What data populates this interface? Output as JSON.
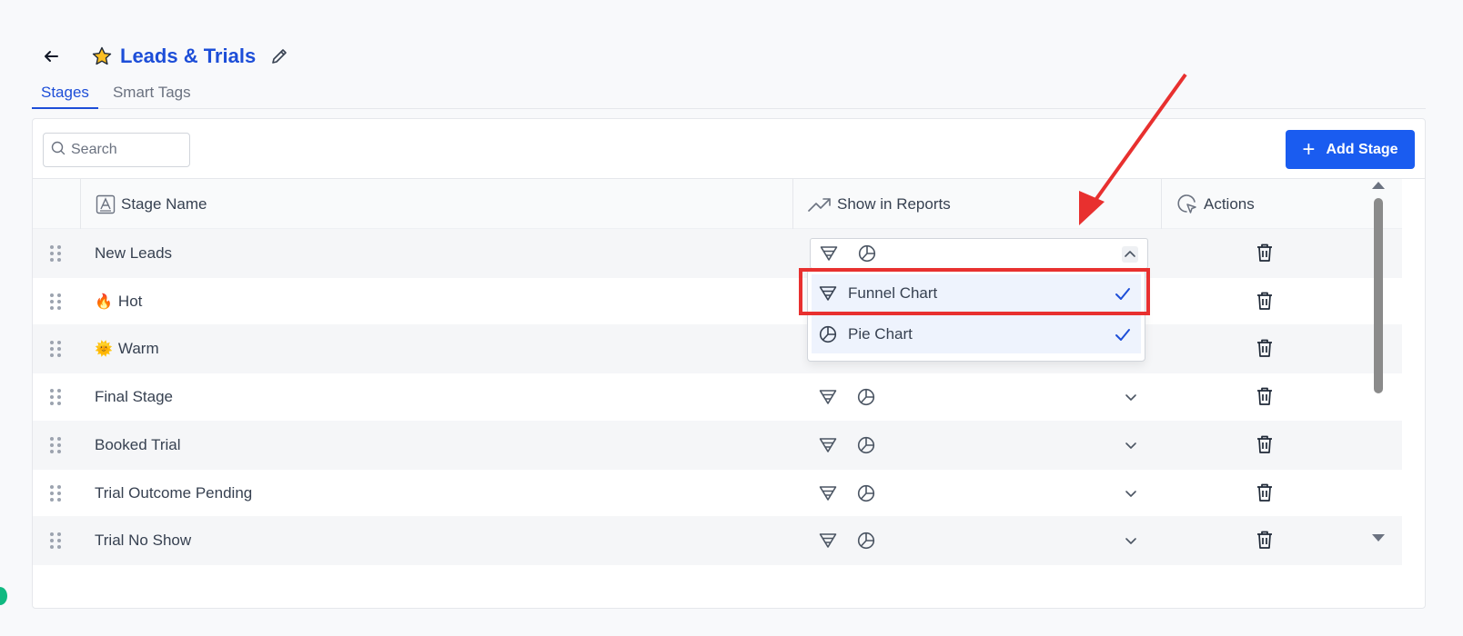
{
  "header": {
    "title": "Leads & Trials"
  },
  "tabs": [
    {
      "label": "Stages",
      "active": true
    },
    {
      "label": "Smart Tags",
      "active": false
    }
  ],
  "toolbar": {
    "search_placeholder": "Search",
    "add_label": "Add Stage"
  },
  "columns": {
    "stage_name": "Stage Name",
    "show_in_reports": "Show in Reports",
    "actions": "Actions"
  },
  "rows": [
    {
      "name": "New Leads",
      "emoji": ""
    },
    {
      "name": "Hot",
      "emoji": "🔥"
    },
    {
      "name": "Warm",
      "emoji": "🌞"
    },
    {
      "name": "Final Stage",
      "emoji": ""
    },
    {
      "name": "Booked Trial",
      "emoji": ""
    },
    {
      "name": "Trial Outcome Pending",
      "emoji": ""
    },
    {
      "name": "Trial No Show",
      "emoji": ""
    }
  ],
  "dropdown": {
    "options": [
      {
        "label": "Funnel Chart",
        "checked": true
      },
      {
        "label": "Pie Chart",
        "checked": true
      }
    ]
  },
  "colors": {
    "accent": "#1a5cf0",
    "title": "#1d4ed8",
    "highlight": "#e8302f"
  }
}
